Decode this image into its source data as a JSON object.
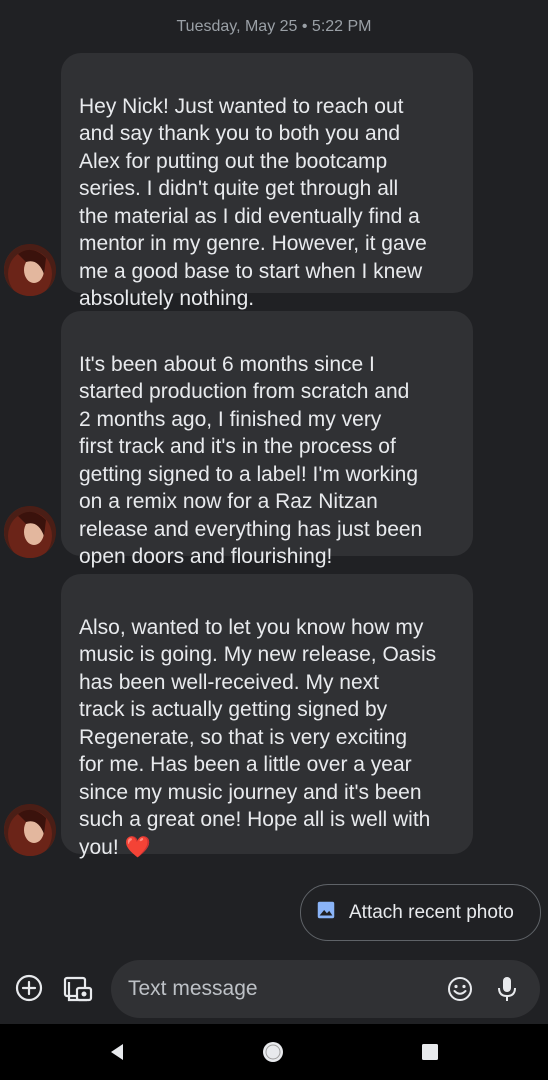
{
  "conversation": {
    "timestamp": "Tuesday, May 25 • 5:22 PM",
    "messages": [
      {
        "text": "Hey Nick! Just wanted to reach out\nand say thank you to both you and\nAlex for putting out the bootcamp\nseries. I didn't quite get through all\nthe material as I did eventually find a\nmentor in my genre. However, it gave\nme a good base to start when I knew\nabsolutely nothing."
      },
      {
        "text": "It's been about 6 months since I\nstarted production from scratch and\n2 months ago, I finished my very\nfirst track and it's in the process of\ngetting signed to a label! I'm working\non a remix now for a Raz Nitzan\nrelease and everything has just been\nopen doors and flourishing!"
      },
      {
        "text": "Also, wanted to let you know how my\nmusic is going. My new release, Oasis\nhas been well-received. My next\ntrack is actually getting signed by\nRegenerate, so that is very exciting\nfor me. Has been a little over a year\nsince my music journey and it's been\nsuch a great one! Hope all is well with\nyou! ",
        "emoji": "❤️"
      }
    ]
  },
  "suggestion": {
    "label": "Attach recent photo",
    "icon": "image-icon"
  },
  "compose": {
    "placeholder": "Text message",
    "icons": [
      "add-icon",
      "gallery-icon",
      "emoji-icon",
      "mic-icon"
    ]
  },
  "navigation": {
    "icons": [
      "back-icon",
      "home-icon",
      "recents-icon"
    ]
  },
  "colors": {
    "background": "#202124",
    "bubble": "#303134",
    "text": "#e8eaed",
    "accent": "#8ab4f8"
  }
}
